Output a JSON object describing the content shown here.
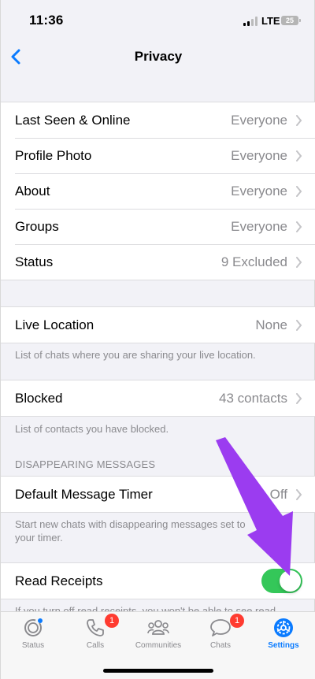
{
  "status_bar": {
    "time": "11:36",
    "network": "LTE",
    "battery": "25"
  },
  "nav": {
    "title": "Privacy"
  },
  "privacy_group": [
    {
      "label": "Last Seen & Online",
      "value": "Everyone"
    },
    {
      "label": "Profile Photo",
      "value": "Everyone"
    },
    {
      "label": "About",
      "value": "Everyone"
    },
    {
      "label": "Groups",
      "value": "Everyone"
    },
    {
      "label": "Status",
      "value": "9 Excluded"
    }
  ],
  "live_location": {
    "label": "Live Location",
    "value": "None",
    "footer": "List of chats where you are sharing your live location."
  },
  "blocked": {
    "label": "Blocked",
    "value": "43 contacts",
    "footer": "List of contacts you have blocked."
  },
  "disappearing": {
    "header": "DISAPPEARING MESSAGES",
    "label": "Default Message Timer",
    "value": "Off",
    "footer": "Start new chats with disappearing messages set to your timer."
  },
  "read_receipts": {
    "label": "Read Receipts",
    "enabled": true,
    "footer": "If you turn off read receipts, you won't be able to see read"
  },
  "tabs": [
    {
      "label": "Status",
      "icon": "status-icon",
      "badge": ""
    },
    {
      "label": "Calls",
      "icon": "phone-icon",
      "badge": "1"
    },
    {
      "label": "Communities",
      "icon": "communities-icon",
      "badge": ""
    },
    {
      "label": "Chats",
      "icon": "chats-icon",
      "badge": "1"
    },
    {
      "label": "Settings",
      "icon": "gear-icon",
      "badge": "",
      "active": true
    }
  ],
  "colors": {
    "accent": "#0a7bff",
    "toggle_on": "#34c759",
    "badge": "#ff3b30",
    "annotation_arrow": "#9b3cf0"
  }
}
